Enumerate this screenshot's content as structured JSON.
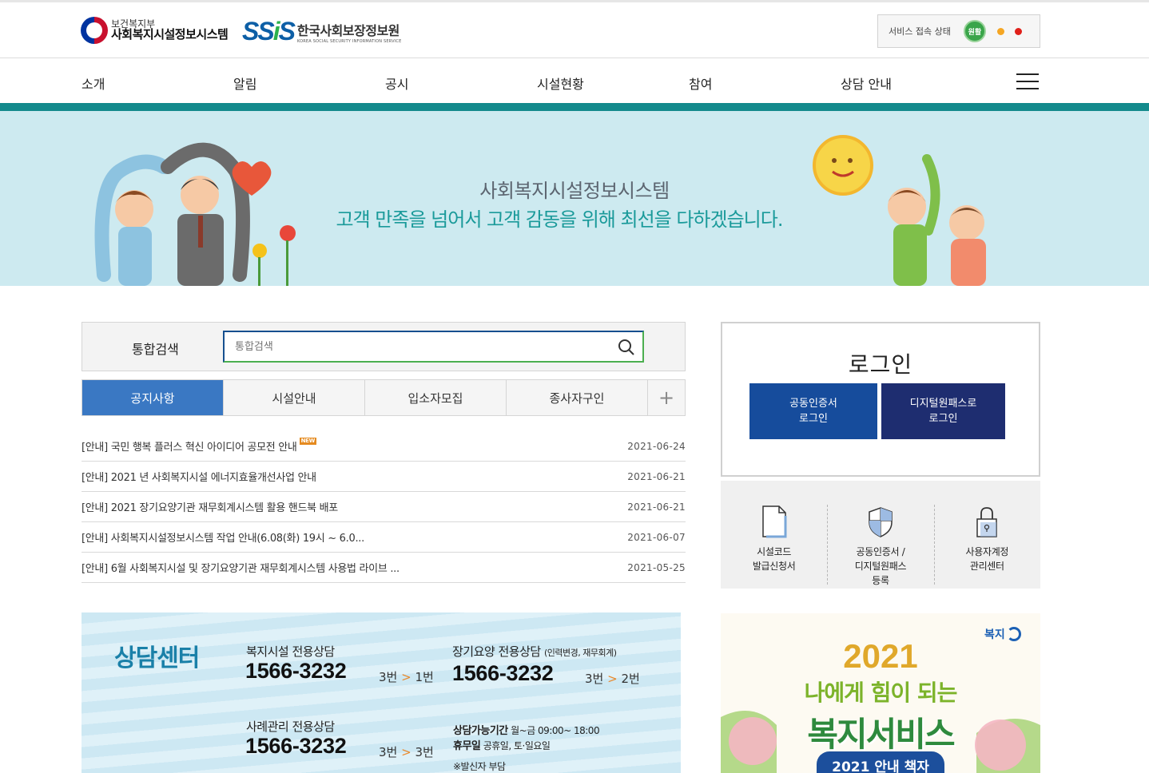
{
  "header": {
    "ministry_small": "보건복지부",
    "ministry_big": "사회복지시설정보시스템",
    "ssis_mark_a": "SS",
    "ssis_mark_b": "i",
    "ssis_mark_c": "S",
    "ssis_kor": "한국사회보장정보원",
    "ssis_eng": "KOREA SOCIAL SECURITY INFORMATION SERVICE",
    "status_label": "서비스 접속 상태",
    "status_badge": "원활",
    "status_colors": {
      "good": "#3aa54a",
      "warn": "#f5a623",
      "bad": "#e0201a"
    }
  },
  "gnb": {
    "items": [
      "소개",
      "알림",
      "공시",
      "시설현황",
      "참여",
      "상담 안내"
    ],
    "menu_icon": "hamburger-icon"
  },
  "banner": {
    "title": "사회복지시설정보시스템",
    "slogan": "고객 만족을 넘어서 고객 감동을 위해 최선을 다하겠습니다."
  },
  "search": {
    "label": "통합검색",
    "placeholder": "통합검색",
    "icon": "search-icon"
  },
  "tabs": {
    "items": [
      "공지사항",
      "시설안내",
      "입소자모집",
      "종사자구인"
    ],
    "active": "공지사항",
    "more": "+"
  },
  "notices": [
    {
      "title": "[안내] 국민 행복 플러스 혁신 아이디어 공모전 안내",
      "date": "2021-06-24",
      "badge": "NEW"
    },
    {
      "title": "[안내] 2021 년 사회복지시설 에너지효율개선사업 안내",
      "date": "2021-06-21"
    },
    {
      "title": "[안내] 2021 장기요양기관 재무회계시스템 활용 핸드북 배포",
      "date": "2021-06-21"
    },
    {
      "title": "[안내] 사회복지시설정보시스템 작업 안내(6.08(화) 19시 ~ 6.0...",
      "date": "2021-06-07"
    },
    {
      "title": "[안내] 6월 사회복지시설 및 장기요양기관 재무회계시스템 사용법 라이브 ...",
      "date": "2021-05-25"
    }
  ],
  "counsel": {
    "title": "상담센터",
    "c1_label": "복지시설 전용상담",
    "c1_number": "1566-3232",
    "c1_ext_a": "3번",
    "c1_arrow": ">",
    "c1_ext_b": "1번",
    "c2_label": "장기요양 전용상담",
    "c2_note": "(인력변경, 재무회계)",
    "c2_number": "1566-3232",
    "c2_ext_a": "3번",
    "c2_arrow": ">",
    "c2_ext_b": "2번",
    "c3_label": "사례관리 전용상담",
    "c3_number": "1566-3232",
    "c3_ext_a": "3번",
    "c3_arrow": ">",
    "c3_ext_b": "3번",
    "hours_label": "상담가능기간",
    "hours_value": "월~금 09:00~ 18:00",
    "holiday_label": "휴무일",
    "holiday_value": "공휴일, 토·일요일",
    "charge_note": "※발신자 부담"
  },
  "login": {
    "title": "로그인",
    "cert_line1": "공동인증서",
    "cert_line2": "로그인",
    "digital_line1": "디지털원패스로",
    "digital_line2": "로그인"
  },
  "quick": [
    {
      "label": "시설코드\n발급신청서",
      "icon": "document-icon"
    },
    {
      "label": "공동인증서 /\n디지털원패스\n등록",
      "icon": "shield-icon"
    },
    {
      "label": "사용자계정\n관리센터",
      "icon": "lock-icon"
    }
  ],
  "welfare": {
    "logo": "복지",
    "year": "2021",
    "subtitle": "나에게 힘이 되는",
    "main": "복지서비스",
    "guide": "2021 안내 책자"
  }
}
